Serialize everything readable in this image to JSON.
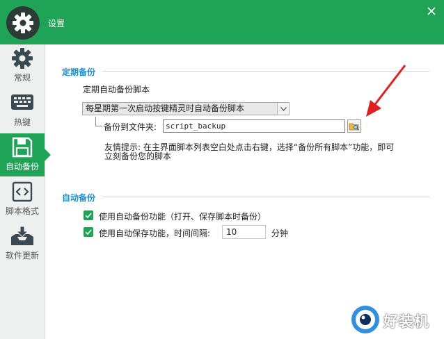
{
  "titlebar": {
    "title": "设置",
    "logo_icon": "gear-icon",
    "close_icon": "close-icon",
    "color": "#1fa356"
  },
  "sidebar": {
    "items": [
      {
        "label": "常规",
        "icon": "gear-icon",
        "active": false
      },
      {
        "label": "热键",
        "icon": "keyboard-icon",
        "active": false
      },
      {
        "label": "自动备份",
        "icon": "floppy-disk-icon",
        "active": true
      },
      {
        "label": "脚本格式",
        "icon": "code-icon",
        "active": false
      },
      {
        "label": "软件更新",
        "icon": "download-tray-icon",
        "active": false
      }
    ]
  },
  "scheduled_backup": {
    "section_title": "定期备份",
    "script_label": "定期自动备份脚本",
    "schedule_selected": "每星期第一次启动按键精灵时自动备份脚本",
    "folder_label": "备份到文件夹:",
    "folder_value": "script_backup",
    "browse_icon": "folder-browse-icon",
    "tip": "友情提示: 在主界面脚本列表空白处点击右键，选择“备份所有脚本”功能，即可立刻备份您的脚本"
  },
  "auto_backup": {
    "section_title": "自动备份",
    "option1_label": "使用自动备份功能（打开、保存脚本时备份）",
    "option1_checked": true,
    "option2_label": "使用自动保存功能，时间间隔:",
    "option2_checked": true,
    "interval_value": "10",
    "interval_unit": "分钟"
  },
  "watermark": {
    "text": "好装机",
    "icon": "eye-logo-icon"
  },
  "colors": {
    "accent": "#1fa356",
    "section_title": "#1a8fd8",
    "annotation_arrow": "#e02020"
  }
}
